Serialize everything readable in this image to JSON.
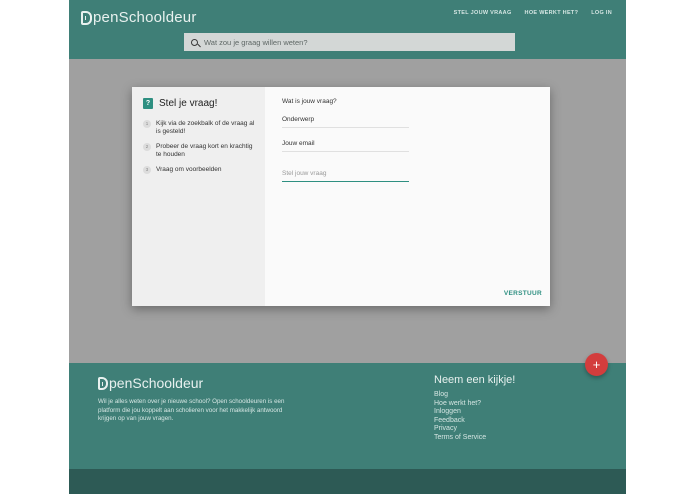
{
  "header": {
    "logo_text": "penSchooldeur",
    "nav": [
      "STEL JOUW VRAAG",
      "HOE WERKT HET?",
      "LOG IN"
    ],
    "search_placeholder": "Wat zou je graag willen weten?"
  },
  "modal": {
    "title": "Stel je vraag!",
    "tips": [
      {
        "num": "1",
        "text": "Kijk via de zoekbalk of de vraag al is gesteld!"
      },
      {
        "num": "2",
        "text": "Probeer de vraag kort en krachtig te houden"
      },
      {
        "num": "3",
        "text": "Vraag om voorbeelden"
      }
    ],
    "form_heading": "Wat is jouw vraag?",
    "subject_placeholder": "Onderwerp",
    "email_placeholder": "Jouw email",
    "question_placeholder": "Stel jouw vraag",
    "submit_label": "VERSTUUR"
  },
  "fab_label": "+",
  "footer": {
    "logo_text": "penSchooldeur",
    "description": "Wil je alles weten over je nieuwe school? Open schooldeuren is een platform die jou koppelt aan scholieren voor het makkelijk antwoord krijgen op van jouw vragen.",
    "links_heading": "Neem een kijkje!",
    "links": [
      "Blog",
      "Hoe werkt het?",
      "Inloggen",
      "Feedback",
      "Privacy",
      "Terms of Service"
    ]
  },
  "colors": {
    "brand": "#3f7f77",
    "accent": "#2e8f81",
    "fab": "#d33d3d"
  }
}
